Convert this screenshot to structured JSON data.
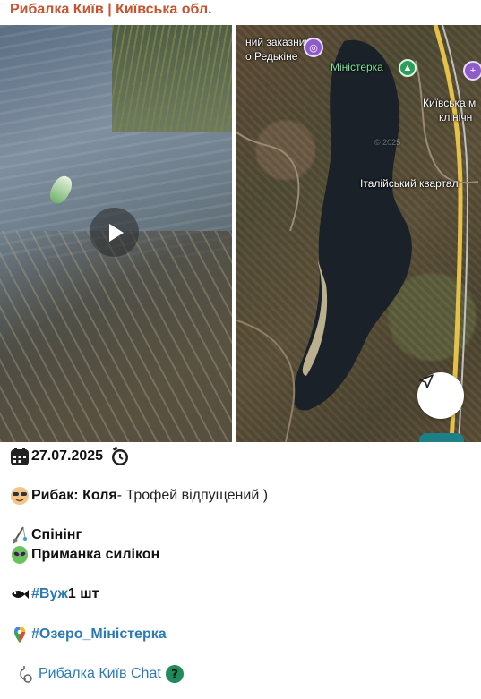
{
  "channel": {
    "title": "Рибалка Київ | Київська обл."
  },
  "video": {
    "play_icon": "play-icon"
  },
  "map": {
    "labels": {
      "reserve": "ний заказник",
      "reserve2": "о Редькіне",
      "lake": "Міністерка",
      "region": "Київська м",
      "region2": "клінічн",
      "quarter": "Італійський квартал",
      "faint": "© 2025"
    },
    "icons": {
      "navigate": "navigation-arrow-icon",
      "park": "park-pin-icon",
      "reserve": "reserve-pin-icon"
    }
  },
  "caption": {
    "date": "27.07.2025",
    "fisher_label": "Рибак: Коля",
    "fisher_note": " - Трофей відпущений )",
    "tackle": "Спінінг",
    "bait": "Приманка силікон",
    "catch_tag": "#Вуж",
    "catch_count": " 1 шт",
    "location_tag": "#Озеро_Міністерка",
    "chat_link": "Рибалка Київ Chat"
  },
  "colors": {
    "title": "#c8532f",
    "link": "#2a7ab8",
    "lake": "#1b2129",
    "road": "#e6c14a"
  }
}
